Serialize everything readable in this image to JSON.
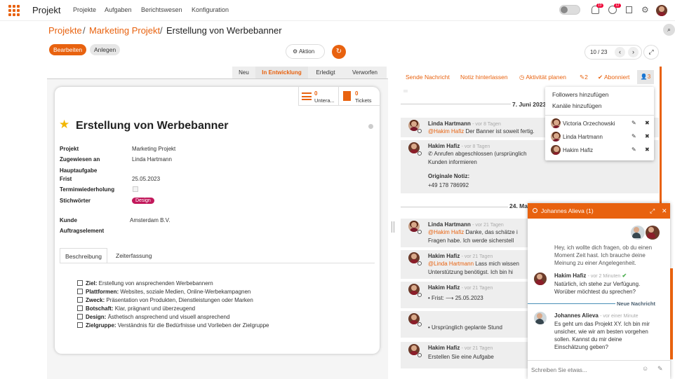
{
  "nav": {
    "brand": "Projekt",
    "items": [
      "Projekte",
      "Aufgaben",
      "Berichtswesen",
      "Konfiguration"
    ],
    "badge1": "10",
    "badge2": "12"
  },
  "breadcrumb": {
    "p1": "Projekte",
    "sep": "/",
    "p2": "Marketing Projekt",
    "p3": "Erstellung von Werbebanner"
  },
  "actions": {
    "edit": "Bearbeiten",
    "create": "Anlegen",
    "action": "Aktion",
    "pager": "10 / 23"
  },
  "stages": [
    "Neu",
    "In Entwicklung",
    "Erledigt",
    "Verworfen"
  ],
  "card": {
    "subtasks_count": "0",
    "subtasks_label": "Untera...",
    "tickets_count": "0",
    "tickets_label": "Tickets",
    "title": "Erstellung von Werbebanner",
    "fields": {
      "projekt_l": "Projekt",
      "projekt_v": "Marketing Projekt",
      "zugew_l": "Zugewiesen an",
      "zugew_v": "Linda Hartmann",
      "haupt_l": "Hauptaufgabe",
      "frist_l": "Frist",
      "frist_v": "25.05.2023",
      "termin_l": "Terminwiederholung",
      "stich_l": "Stichwörter",
      "stich_v": "Design",
      "kunde_l": "Kunde",
      "kunde_v": "Amsterdam B.V.",
      "auftrag_l": "Auftragselement"
    },
    "tabs": [
      "Beschreibung",
      "Zeiterfassung"
    ],
    "desc": [
      {
        "k": "Ziel:",
        "v": " Erstellung von ansprechenden Werbebannern"
      },
      {
        "k": "Plattformen:",
        "v": " Websites, soziale Medien, Online-Werbekampagnen"
      },
      {
        "k": "Zweck:",
        "v": " Präsentation von Produkten, Dienstleistungen oder Marken"
      },
      {
        "k": "Botschaft:",
        "v": " Klar, prägnant und überzeugend"
      },
      {
        "k": "Design:",
        "v": " Ästhetisch ansprechend und visuell ansprechend"
      },
      {
        "k": "Zielgruppe:",
        "v": " Verständnis für die Bedürfnisse und Vorlieben der Zielgruppe"
      }
    ]
  },
  "chatter": {
    "send": "Sende Nachricht",
    "note": "Notiz hinterlassen",
    "activity": "Aktivität planen",
    "attach": "2",
    "follow": "Abonniert",
    "followers": "3",
    "date1": "7. Juni 2023",
    "date2": "24. Ma",
    "m1": {
      "a": "Linda Hartmann",
      "t": "- vor 8 Tagen",
      "mention": "@Hakim Hafiz",
      "text": " Der Banner ist soweit fertig."
    },
    "m2": {
      "a": "Hakim Hafiz",
      "t": "- vor 8 Tagen",
      "l1": "Anrufen abgeschlossen (ursprünglich",
      "l2": "Kunden informieren",
      "nl": "Originale Notiz:",
      "phone": "+49 178 786992"
    },
    "m3": {
      "a": "Linda Hartmann",
      "t": "- vor 21 Tagen",
      "mention": "@Hakim Hafiz",
      "l1": " Danke, das schätze i",
      "l2": "Fragen habe. Ich werde sicherstell"
    },
    "m4": {
      "a": "Hakim Hafiz",
      "t": "- vor 21 Tagen",
      "mention": "@Linda Hartmann",
      "l1": " Lass mich wissen",
      "l2": "Unterstützung benötigst. Ich bin hi"
    },
    "m5": {
      "a": "Hakim Hafiz",
      "t": "- vor 21 Tagen",
      "l1": "Frist: ⟶ 25.05.2023"
    },
    "m6": {
      "a": "",
      "t": "",
      "l1": "Ursprünglich geplante Stund"
    },
    "m7": {
      "a": "Hakim Hafiz",
      "t": "- vor 21 Tagen",
      "l1": "Erstellen Sie eine Aufgabe"
    }
  },
  "dropdown": {
    "add_followers": "Followers hinzufügen",
    "add_channels": "Kanäle hinzufügen",
    "people": [
      "Victoria Orzechowski",
      "Linda Hartmann",
      "Hakim Hafiz"
    ]
  },
  "chatwin": {
    "title": "Johannes Alieva (1)",
    "prev": "Hey, ich wollte dich fragen, ob du einen Moment Zeit hast. Ich brauche deine Meinung zu einer Angelegenheit.",
    "prev_l1": "Hey, ich wollte dich fragen, ob du einen",
    "prev_l2": "Moment Zeit hast. Ich brauche deine",
    "prev_l3": "Meinung zu einer Angelegenheit.",
    "h_author": "Hakim Hafiz",
    "h_time": "- vor 2 Minuten",
    "h_l1": "Natürlich, ich stehe zur Verfügung.",
    "h_l2": "Worüber möchtest du sprechen?",
    "new_msg": "Neue Nachricht",
    "j_author": "Johannes Alieva",
    "j_time": "- vor einer Minute",
    "j_l1": "Es geht um das Projekt XY. Ich bin mir",
    "j_l2": "unsicher, wie wir am besten vorgehen",
    "j_l3": "sollen. Kannst du mir deine",
    "j_l4": "Einschätzung geben?",
    "placeholder": "Schreiben Sie etwas..."
  }
}
